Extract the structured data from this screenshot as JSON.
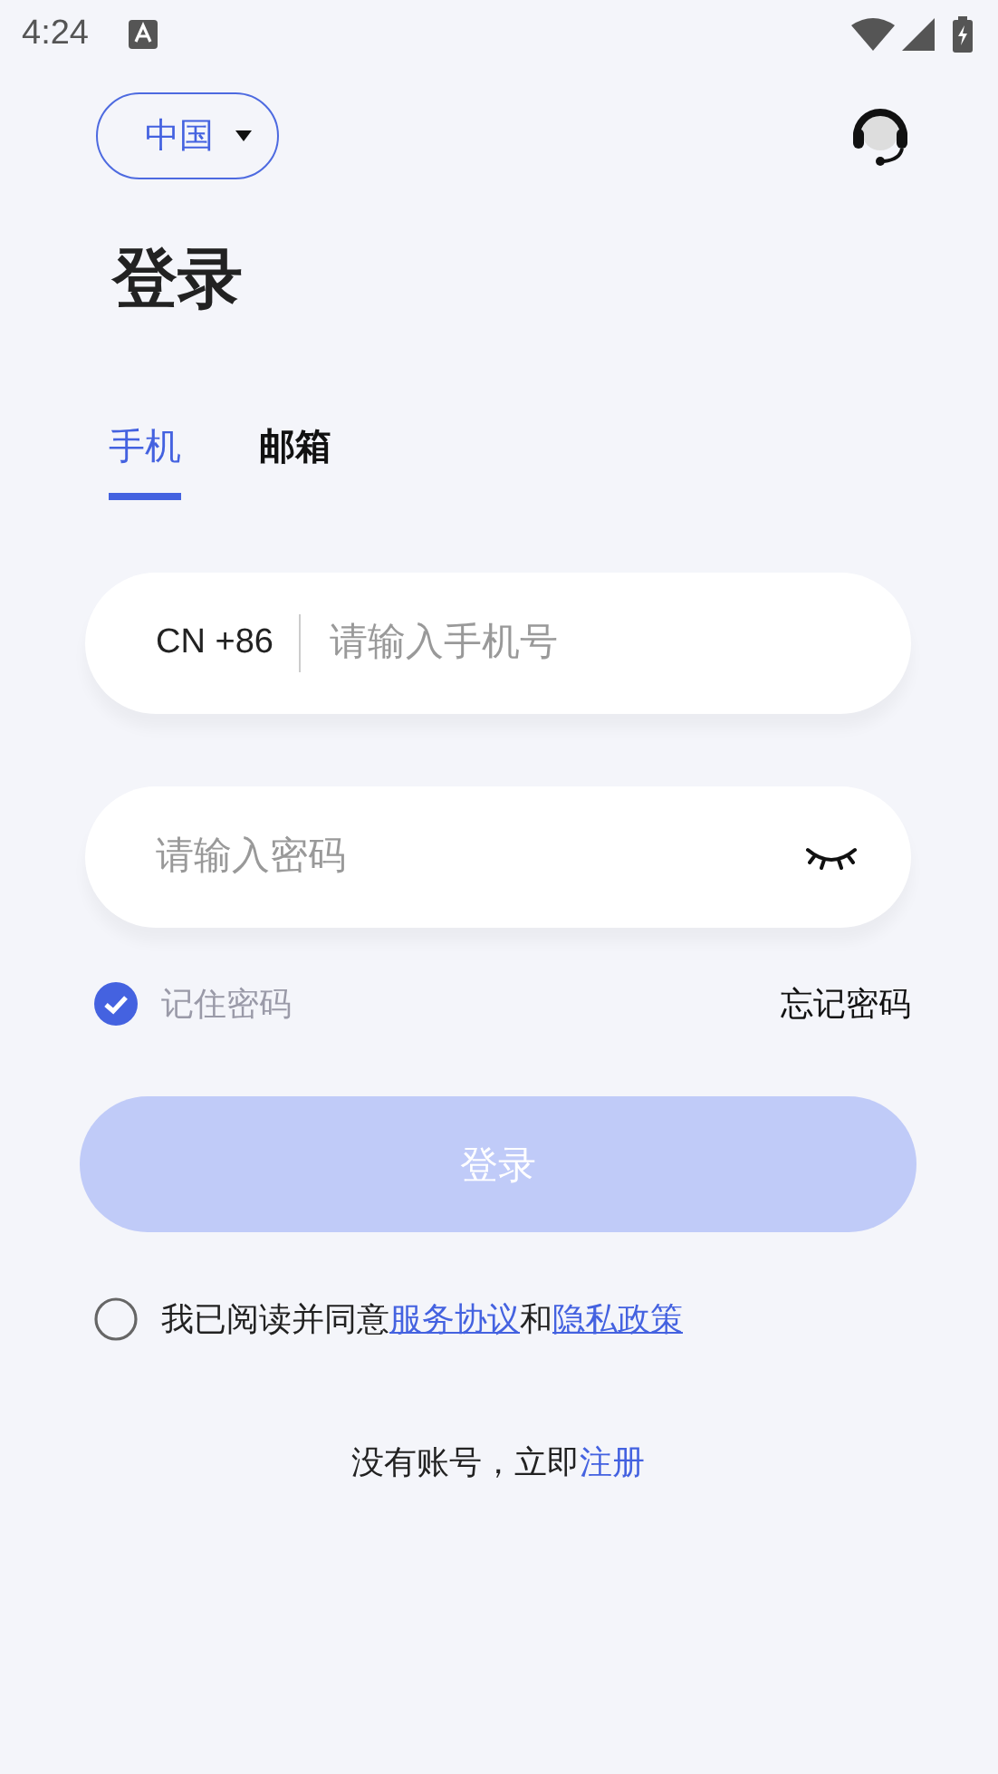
{
  "status_bar": {
    "time": "4:24"
  },
  "region": {
    "label": "中国"
  },
  "title": "登录",
  "tabs": [
    {
      "label": "手机",
      "selected": true
    },
    {
      "label": "邮箱",
      "selected": false
    }
  ],
  "phone_field": {
    "country_code": "CN +86",
    "placeholder": "请输入手机号"
  },
  "password_field": {
    "placeholder": "请输入密码",
    "visible": false
  },
  "remember": {
    "label": "记住密码",
    "checked": true
  },
  "forgot_link": "忘记密码",
  "login_button": {
    "label": "登录",
    "disabled": true
  },
  "agreement": {
    "checked": false,
    "parts": [
      {
        "kind": "text",
        "text": "我已阅读并同意"
      },
      {
        "kind": "link",
        "text": "服务协议"
      },
      {
        "kind": "text",
        "text": "和"
      },
      {
        "kind": "link",
        "text": "隐私政策"
      }
    ]
  },
  "register": {
    "parts": [
      {
        "kind": "text",
        "text": "没有账号，立即"
      },
      {
        "kind": "link",
        "text": "注册"
      }
    ]
  }
}
